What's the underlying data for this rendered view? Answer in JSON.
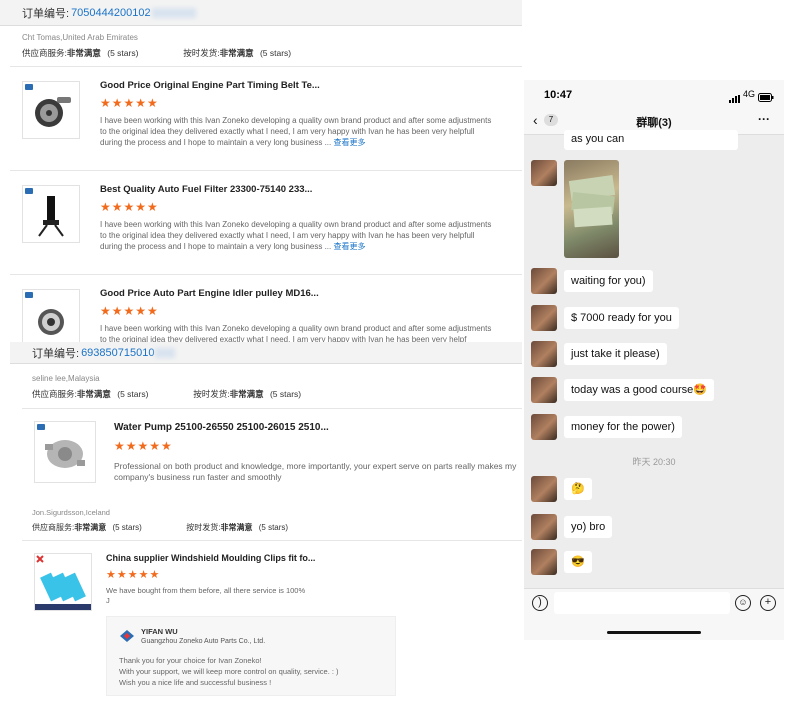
{
  "left_panel_1": {
    "order_label": "订单编号:",
    "order_number": "7050444200102",
    "buyer": "Cht Tomas,United Arab Emirates",
    "supplier_service_label": "供应商服务:",
    "supplier_service_value": "非常满意",
    "supplier_service_stars": "(5 stars)",
    "on_time_label": "按时发货:",
    "on_time_value": "非常满意",
    "on_time_stars": "(5 stars)",
    "items": [
      {
        "title": "Good Price Original Engine Part Timing Belt Te...",
        "stars": "★★★★★",
        "review": "I have been working with this Ivan Zoneko developing a quality own brand product and after some adjustments to the original idea they delivered exactly what I need, I am very happy with Ivan he has been very helpfull during the process and I hope to maintain a very long business ...",
        "more": "查看更多"
      },
      {
        "title": "Best Quality Auto Fuel Filter 23300-75140 233...",
        "stars": "★★★★★",
        "review": "I have been working with this Ivan Zoneko developing a quality own brand product and after some adjustments to the original idea they delivered exactly what I need, I am very happy with Ivan he has been very helpfull during the process and I hope to maintain a very long business ...",
        "more": "查看更多"
      },
      {
        "title": "Good Price Auto Part Engine Idler pulley MD16...",
        "stars": "★★★★★",
        "review": "I have been working with this Ivan Zoneko developing a quality own brand product and after some adjustments to the original idea they delivered exactly what I need, I am very happy with Ivan he has been very helpf",
        "more": ""
      }
    ]
  },
  "left_panel_2": {
    "order_label": "订单编号:",
    "order_number": "693850715010",
    "buyer": "seline lee,Malaysia",
    "supplier_service_label": "供应商服务:",
    "supplier_service_value": "非常满意",
    "supplier_service_stars": "(5 stars)",
    "on_time_label": "按时发货:",
    "on_time_value": "非常满意",
    "on_time_stars": "(5 stars)",
    "item": {
      "title": "Water Pump 25100-26550 25100-26015 2510...",
      "stars": "★★★★★",
      "review": "Professional on both product and knowledge, more importantly, your expert serve on parts really makes my company's business run faster and smoothly"
    }
  },
  "left_panel_3": {
    "buyer": "Jon.Sigurdsson,Iceland",
    "supplier_service_label": "供应商服务:",
    "supplier_service_value": "非常满意",
    "supplier_service_stars": "(5 stars)",
    "on_time_label": "按时发货:",
    "on_time_value": "非常满意",
    "on_time_stars": "(5 stars)",
    "item": {
      "title": "China supplier Windshield Moulding Clips fit fo...",
      "stars": "★★★★★",
      "review": "We have bought from them before, all there service is 100%",
      "review_line2": "J"
    },
    "reply": {
      "name": "YIFAN WU",
      "company": "Guangzhou Zoneko Auto Parts Co., Ltd.",
      "line1": "Thank you for your choice for Ivan Zoneko!",
      "line2": "With your support, we will keep more control on quality, service. : )",
      "line3": "Wish you a nice life and successful business !"
    }
  },
  "phone": {
    "time": "10:47",
    "network": "4G",
    "back_count": "7",
    "chat_title": "群聊(3)",
    "more": "···",
    "messages": [
      {
        "text": "as you can"
      },
      {
        "text": "waiting for you)"
      },
      {
        "text": "$ 7000 ready for you"
      },
      {
        "text": "just take it please)"
      },
      {
        "text": "today was a good course🤩"
      },
      {
        "text": "money for the power)"
      },
      {
        "text": "🤔"
      },
      {
        "text": "yo) bro"
      },
      {
        "text": "😎"
      }
    ],
    "timestamp": "昨天 20:30"
  }
}
